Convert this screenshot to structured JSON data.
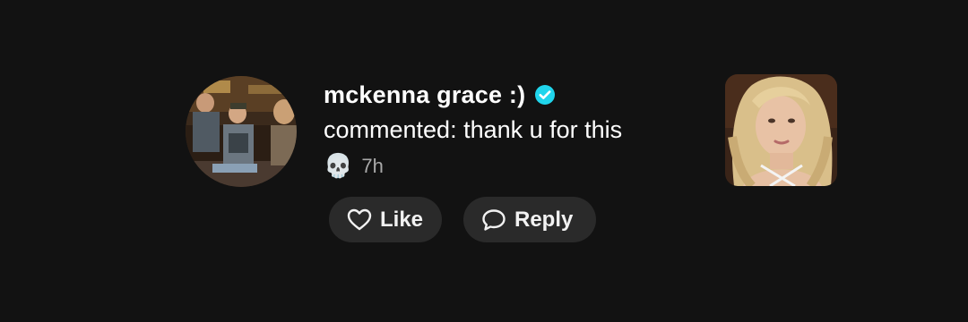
{
  "notification": {
    "username": "mckenna grace :)",
    "verified_icon": "verified-badge-icon",
    "comment_text": "commented: thank u for this",
    "reaction_emoji": "💀",
    "time_ago": "7h"
  },
  "actions": {
    "like_label": "Like",
    "reply_label": "Reply",
    "like_icon": "heart-outline-icon",
    "reply_icon": "speech-bubble-icon"
  },
  "colors": {
    "background": "#121212",
    "pill_background": "#2a2a2a",
    "verified_blue": "#20d5ec",
    "text_primary": "#ffffff",
    "text_secondary": "#a9a9a9"
  }
}
